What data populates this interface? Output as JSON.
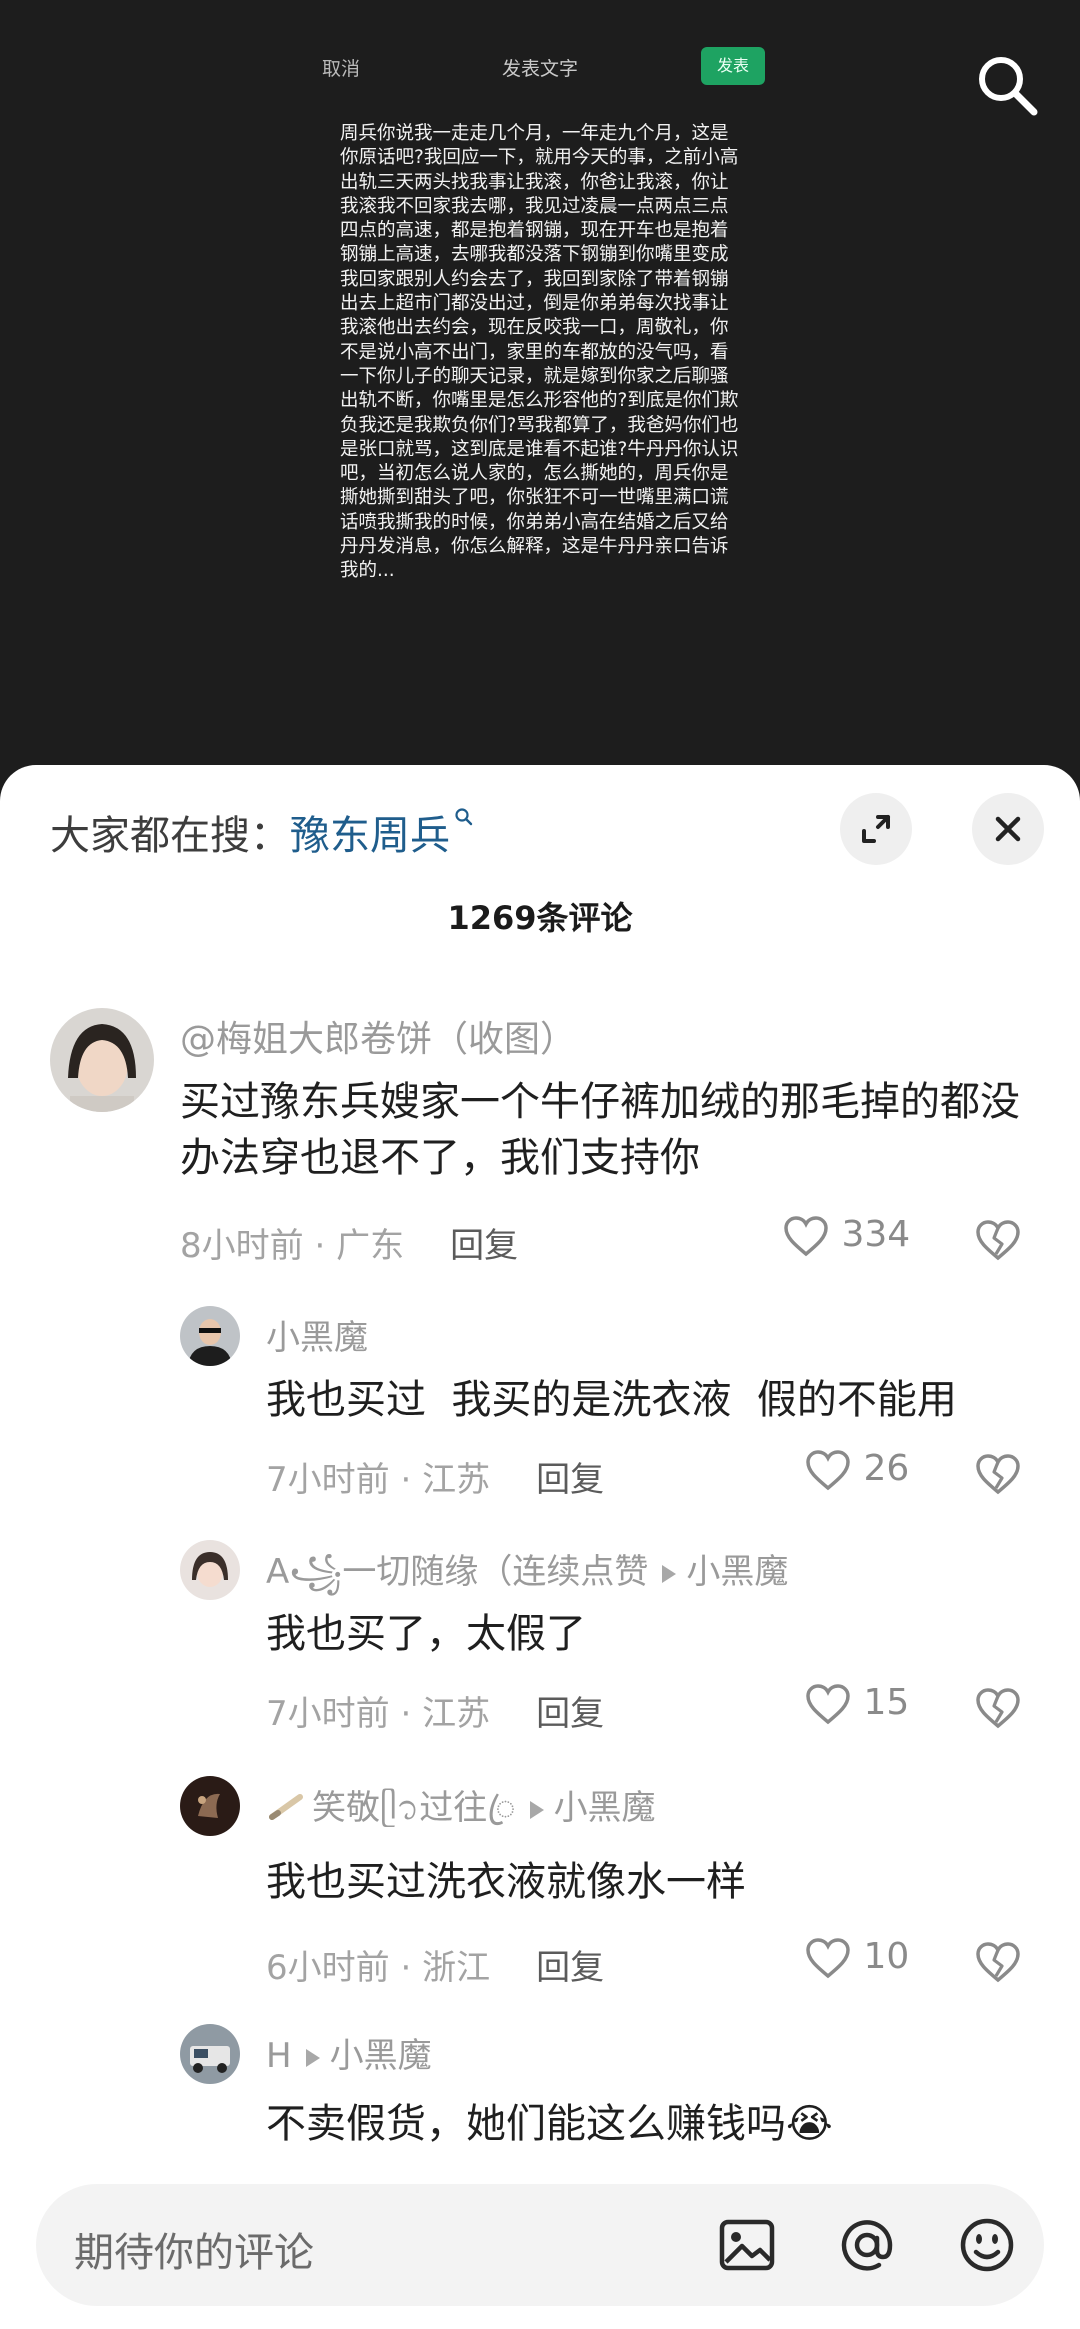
{
  "video": {
    "cancel_label": "取消",
    "title": "发表文字",
    "publish_label": "发表",
    "caption": "周兵你说我一走走几个月，一年走九个月，这是你原话吧?我回应一下，就用今天的事，之前小高出轨三天两头找我事让我滚，你爸让我滚，你让我滚我不回家我去哪，我见过凌晨一点两点三点四点的高速，都是抱着钢镚，现在开车也是抱着钢镚上高速，去哪我都没落下钢镚到你嘴里变成我回家跟别人约会去了，我回到家除了带着钢镚出去上超市门都没出过，倒是你弟弟每次找事让我滚他出去约会，现在反咬我一口，周敬礼，你不是说小高不出门，家里的车都放的没气吗，看一下你儿子的聊天记录，就是嫁到你家之后聊骚出轨不断，你嘴里是怎么形容他的?到底是你们欺负我还是我欺负你们?骂我都算了，我爸妈你们也是张口就骂，这到底是谁看不起谁?牛丹丹你认识吧，当初怎么说人家的，怎么撕她的，周兵你是撕她撕到甜头了吧，你张狂不可一世嘴里满口谎话喷我撕我的时候，你弟弟小高在结婚之后又给丹丹发消息，你怎么解释，这是牛丹丹亲口告诉我的..."
  },
  "sheet": {
    "hot_prefix": "大家都在搜：",
    "hot_keyword": "豫东周兵",
    "count_label": "1269条评论"
  },
  "comments": [
    {
      "user": "@梅姐大郎卷饼（收图）",
      "text": "买过豫东兵嫂家一个牛仔裤加绒的那毛掉的都没办法穿也退不了，我们支持你",
      "time": "8小时前",
      "region": "广东",
      "reply_label": "回复",
      "likes": "334"
    },
    {
      "user": "小黑魔",
      "text": "我也买过  我买的是洗衣液  假的不能用",
      "time": "7小时前",
      "region": "江苏",
      "reply_label": "回复",
      "likes": "26"
    },
    {
      "user": "A꧁一切随缘（连续点赞",
      "reply_to": "小黑魔",
      "text": "我也买了，太假了",
      "time": "7小时前",
      "region": "江苏",
      "reply_label": "回复",
      "likes": "15"
    },
    {
      "user": "笑敬ᥫ᭡过往ꦿ",
      "reply_to": "小黑魔",
      "text": "我也买过洗衣液就像水一样",
      "time": "6小时前",
      "region": "浙江",
      "reply_label": "回复",
      "likes": "10"
    },
    {
      "user": "H",
      "reply_to": "小黑魔",
      "text": "不卖假货，她们能这么赚钱吗",
      "emoji": "😭"
    }
  ],
  "input": {
    "placeholder": "期待你的评论"
  },
  "colors": {
    "publish_green": "#1ea362",
    "keyword_blue": "#1f5d8c"
  },
  "icons": {
    "search": "search-icon",
    "expand": "expand-icon",
    "close": "close-icon",
    "like": "heart-icon",
    "dislike": "broken-heart-icon",
    "image": "image-icon",
    "mention": "at-icon",
    "emoji": "emoji-icon"
  }
}
